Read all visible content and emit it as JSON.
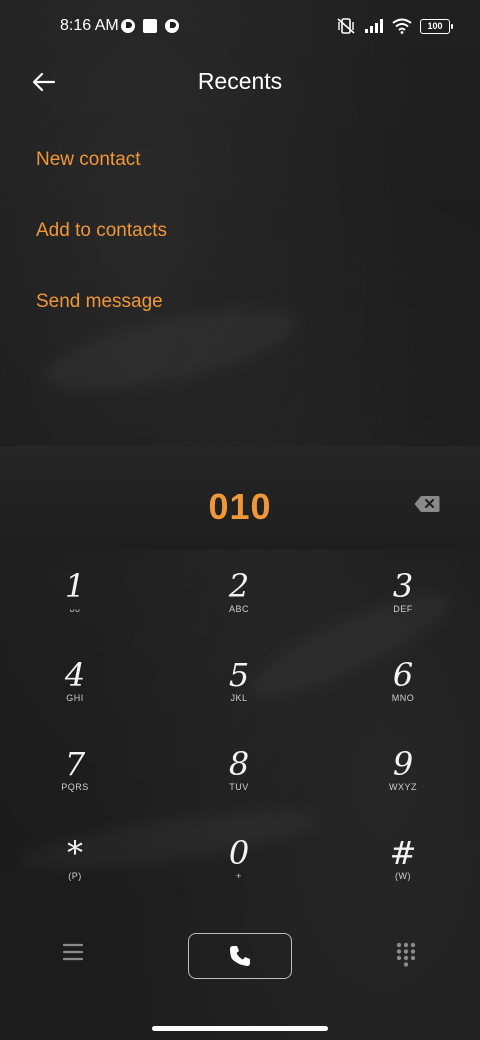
{
  "status_bar": {
    "time": "8:16 AM",
    "battery": "100"
  },
  "header": {
    "title": "Recents"
  },
  "actions": [
    {
      "label": "New contact"
    },
    {
      "label": "Add to contacts"
    },
    {
      "label": "Send message"
    }
  ],
  "dialer": {
    "number": "010"
  },
  "keys": [
    {
      "digit": "1",
      "letters": "ᴗᴗ"
    },
    {
      "digit": "2",
      "letters": "ABC"
    },
    {
      "digit": "3",
      "letters": "DEF"
    },
    {
      "digit": "4",
      "letters": "GHI"
    },
    {
      "digit": "5",
      "letters": "JKL"
    },
    {
      "digit": "6",
      "letters": "MNO"
    },
    {
      "digit": "7",
      "letters": "PQRS"
    },
    {
      "digit": "8",
      "letters": "TUV"
    },
    {
      "digit": "9",
      "letters": "WXYZ"
    },
    {
      "digit": "*",
      "letters": "(P)"
    },
    {
      "digit": "0",
      "letters": "+"
    },
    {
      "digit": "#",
      "letters": "(W)"
    }
  ],
  "colors": {
    "accent": "#f0973a",
    "background": "#1d1d1d",
    "text": "#ffffff"
  },
  "icons": {
    "back": "arrow-left-icon",
    "backspace": "backspace-icon",
    "menu": "hamburger-menu-icon",
    "call": "phone-icon",
    "keypad": "dialpad-icon"
  }
}
